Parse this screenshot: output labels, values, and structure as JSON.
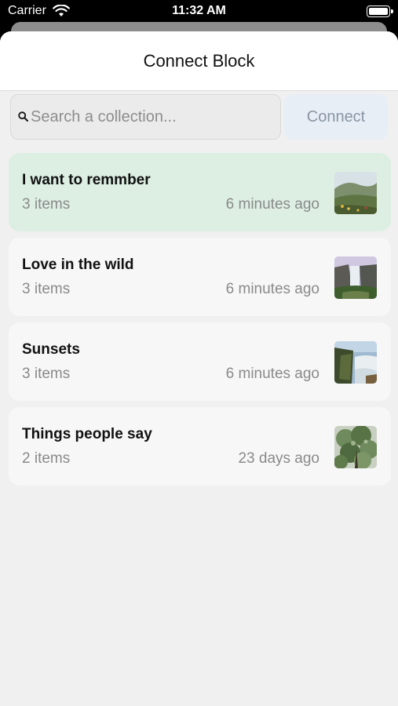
{
  "status_bar": {
    "carrier": "Carrier",
    "time": "11:32 AM"
  },
  "sheet": {
    "title": "Connect Block"
  },
  "search": {
    "placeholder": "Search a collection...",
    "value": ""
  },
  "connect_button": {
    "label": "Connect"
  },
  "collections": [
    {
      "title": "I want to remmber",
      "count": "3 items",
      "updated": "6 minutes ago",
      "selected": true,
      "thumb_icon": "meadow-thumbnail"
    },
    {
      "title": "Love in the wild",
      "count": "3 items",
      "updated": "6 minutes ago",
      "selected": false,
      "thumb_icon": "waterfall-thumbnail"
    },
    {
      "title": "Sunsets",
      "count": "3 items",
      "updated": "6 minutes ago",
      "selected": false,
      "thumb_icon": "cliff-waterfall-thumbnail"
    },
    {
      "title": "Things people say",
      "count": "2 items",
      "updated": "23 days ago",
      "selected": false,
      "thumb_icon": "tree-thumbnail"
    }
  ],
  "colors": {
    "selected_card": "#dcefe2",
    "card": "#f7f7f7",
    "connect_button_bg": "#e7eef6",
    "connect_button_text": "#8a96a4"
  }
}
